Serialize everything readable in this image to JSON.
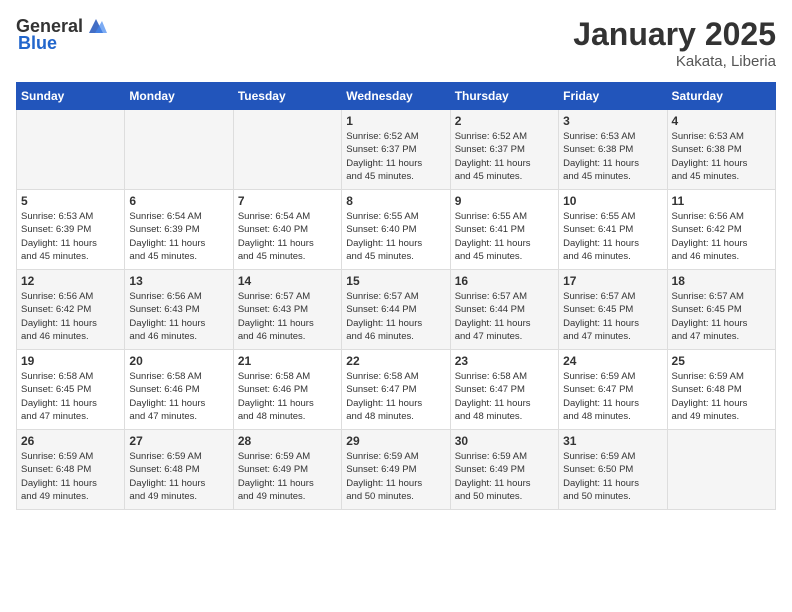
{
  "header": {
    "logo_general": "General",
    "logo_blue": "Blue",
    "month": "January 2025",
    "location": "Kakata, Liberia"
  },
  "weekdays": [
    "Sunday",
    "Monday",
    "Tuesday",
    "Wednesday",
    "Thursday",
    "Friday",
    "Saturday"
  ],
  "weeks": [
    [
      {
        "day": "",
        "info": ""
      },
      {
        "day": "",
        "info": ""
      },
      {
        "day": "",
        "info": ""
      },
      {
        "day": "1",
        "info": "Sunrise: 6:52 AM\nSunset: 6:37 PM\nDaylight: 11 hours\nand 45 minutes."
      },
      {
        "day": "2",
        "info": "Sunrise: 6:52 AM\nSunset: 6:37 PM\nDaylight: 11 hours\nand 45 minutes."
      },
      {
        "day": "3",
        "info": "Sunrise: 6:53 AM\nSunset: 6:38 PM\nDaylight: 11 hours\nand 45 minutes."
      },
      {
        "day": "4",
        "info": "Sunrise: 6:53 AM\nSunset: 6:38 PM\nDaylight: 11 hours\nand 45 minutes."
      }
    ],
    [
      {
        "day": "5",
        "info": "Sunrise: 6:53 AM\nSunset: 6:39 PM\nDaylight: 11 hours\nand 45 minutes."
      },
      {
        "day": "6",
        "info": "Sunrise: 6:54 AM\nSunset: 6:39 PM\nDaylight: 11 hours\nand 45 minutes."
      },
      {
        "day": "7",
        "info": "Sunrise: 6:54 AM\nSunset: 6:40 PM\nDaylight: 11 hours\nand 45 minutes."
      },
      {
        "day": "8",
        "info": "Sunrise: 6:55 AM\nSunset: 6:40 PM\nDaylight: 11 hours\nand 45 minutes."
      },
      {
        "day": "9",
        "info": "Sunrise: 6:55 AM\nSunset: 6:41 PM\nDaylight: 11 hours\nand 45 minutes."
      },
      {
        "day": "10",
        "info": "Sunrise: 6:55 AM\nSunset: 6:41 PM\nDaylight: 11 hours\nand 46 minutes."
      },
      {
        "day": "11",
        "info": "Sunrise: 6:56 AM\nSunset: 6:42 PM\nDaylight: 11 hours\nand 46 minutes."
      }
    ],
    [
      {
        "day": "12",
        "info": "Sunrise: 6:56 AM\nSunset: 6:42 PM\nDaylight: 11 hours\nand 46 minutes."
      },
      {
        "day": "13",
        "info": "Sunrise: 6:56 AM\nSunset: 6:43 PM\nDaylight: 11 hours\nand 46 minutes."
      },
      {
        "day": "14",
        "info": "Sunrise: 6:57 AM\nSunset: 6:43 PM\nDaylight: 11 hours\nand 46 minutes."
      },
      {
        "day": "15",
        "info": "Sunrise: 6:57 AM\nSunset: 6:44 PM\nDaylight: 11 hours\nand 46 minutes."
      },
      {
        "day": "16",
        "info": "Sunrise: 6:57 AM\nSunset: 6:44 PM\nDaylight: 11 hours\nand 47 minutes."
      },
      {
        "day": "17",
        "info": "Sunrise: 6:57 AM\nSunset: 6:45 PM\nDaylight: 11 hours\nand 47 minutes."
      },
      {
        "day": "18",
        "info": "Sunrise: 6:57 AM\nSunset: 6:45 PM\nDaylight: 11 hours\nand 47 minutes."
      }
    ],
    [
      {
        "day": "19",
        "info": "Sunrise: 6:58 AM\nSunset: 6:45 PM\nDaylight: 11 hours\nand 47 minutes."
      },
      {
        "day": "20",
        "info": "Sunrise: 6:58 AM\nSunset: 6:46 PM\nDaylight: 11 hours\nand 47 minutes."
      },
      {
        "day": "21",
        "info": "Sunrise: 6:58 AM\nSunset: 6:46 PM\nDaylight: 11 hours\nand 48 minutes."
      },
      {
        "day": "22",
        "info": "Sunrise: 6:58 AM\nSunset: 6:47 PM\nDaylight: 11 hours\nand 48 minutes."
      },
      {
        "day": "23",
        "info": "Sunrise: 6:58 AM\nSunset: 6:47 PM\nDaylight: 11 hours\nand 48 minutes."
      },
      {
        "day": "24",
        "info": "Sunrise: 6:59 AM\nSunset: 6:47 PM\nDaylight: 11 hours\nand 48 minutes."
      },
      {
        "day": "25",
        "info": "Sunrise: 6:59 AM\nSunset: 6:48 PM\nDaylight: 11 hours\nand 49 minutes."
      }
    ],
    [
      {
        "day": "26",
        "info": "Sunrise: 6:59 AM\nSunset: 6:48 PM\nDaylight: 11 hours\nand 49 minutes."
      },
      {
        "day": "27",
        "info": "Sunrise: 6:59 AM\nSunset: 6:48 PM\nDaylight: 11 hours\nand 49 minutes."
      },
      {
        "day": "28",
        "info": "Sunrise: 6:59 AM\nSunset: 6:49 PM\nDaylight: 11 hours\nand 49 minutes."
      },
      {
        "day": "29",
        "info": "Sunrise: 6:59 AM\nSunset: 6:49 PM\nDaylight: 11 hours\nand 50 minutes."
      },
      {
        "day": "30",
        "info": "Sunrise: 6:59 AM\nSunset: 6:49 PM\nDaylight: 11 hours\nand 50 minutes."
      },
      {
        "day": "31",
        "info": "Sunrise: 6:59 AM\nSunset: 6:50 PM\nDaylight: 11 hours\nand 50 minutes."
      },
      {
        "day": "",
        "info": ""
      }
    ]
  ]
}
